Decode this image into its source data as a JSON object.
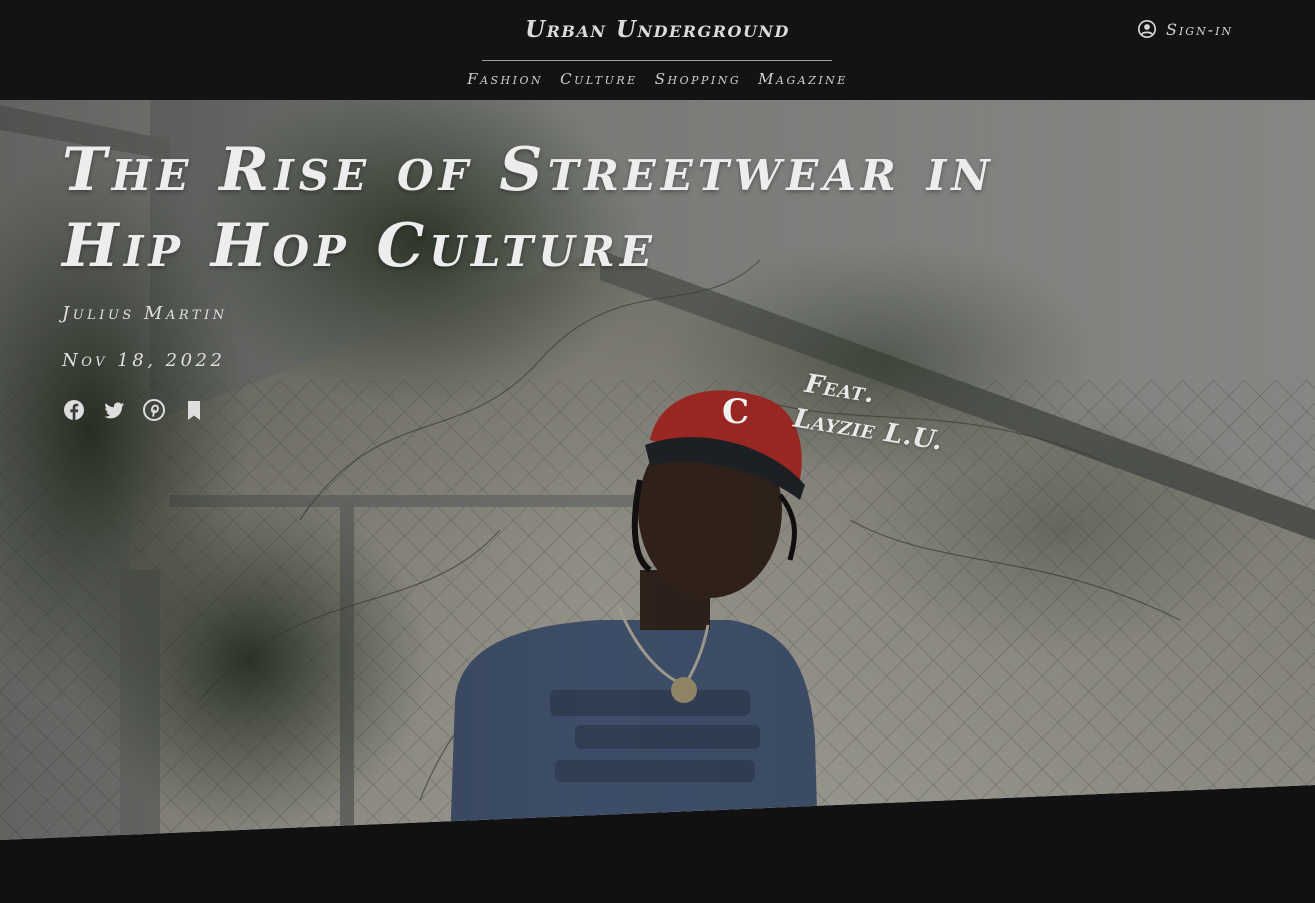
{
  "header": {
    "site_title": "Urban Underground",
    "nav": [
      "Fashion",
      "Culture",
      "Shopping",
      "Magazine"
    ],
    "signin_label": "Sign-in",
    "signin_icon": "user-circle-icon"
  },
  "article": {
    "title_line1": "The Rise of Streetwear in",
    "title_line2": "Hip Hop Culture",
    "author": "Julius Martin",
    "date": "Nov 18, 2022",
    "share_icons": [
      "facebook-icon",
      "twitter-icon",
      "pinterest-icon",
      "bookmark-icon"
    ]
  },
  "hero": {
    "feat_label": "Feat.",
    "feat_name": "Layzie L.U.",
    "cap_letter": "C"
  },
  "colors": {
    "background": "#111111",
    "header": "#131313",
    "text": "#dcdcdc",
    "cap_red": "#c8322c"
  }
}
